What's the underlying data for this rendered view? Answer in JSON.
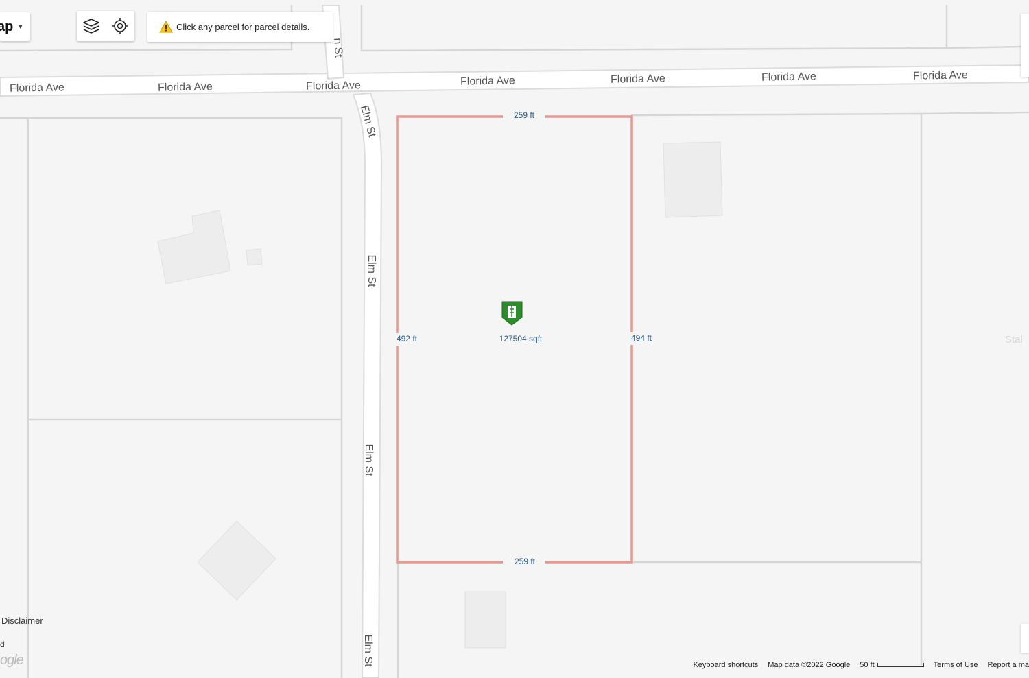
{
  "map_type": {
    "label": "ap"
  },
  "toolbar": {
    "layers_icon": "layers-icon",
    "locate_icon": "crosshair-icon"
  },
  "notice": {
    "text": "Click any parcel for parcel details.",
    "icon": "warning-icon"
  },
  "streets": {
    "florida": "Florida Ave",
    "elm": "Elm St",
    "elm_cut": "n St",
    "right_cut": "Stal"
  },
  "parcel": {
    "area": "127504 sqft",
    "top": "259 ft",
    "bottom": "259 ft",
    "left": "492 ft",
    "right": "494 ft",
    "marker_icon": "parcel-marker-icon",
    "outline_color": "#e49a8f",
    "marker_color": "#2e8b2e"
  },
  "footer": {
    "keyboard": "Keyboard shortcuts",
    "mapdata": "Map data ©2022 Google",
    "scale": "50 ft",
    "terms": "Terms of Use",
    "report": "Report a ma"
  },
  "disclaimer": "Disclaimer",
  "disclaimer_cut": "d",
  "google_logo": "ogle"
}
